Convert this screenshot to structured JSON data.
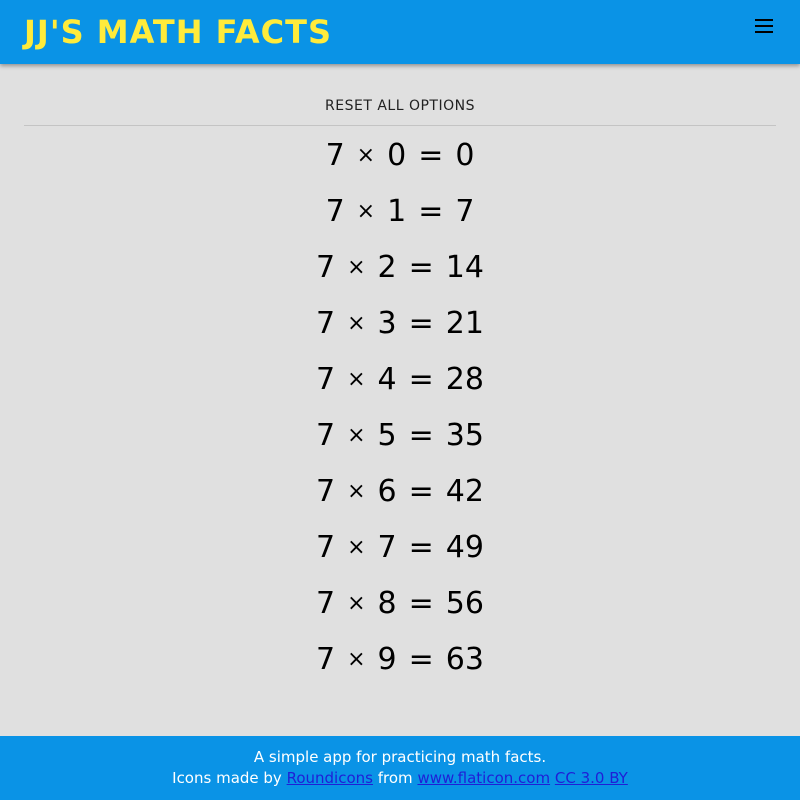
{
  "header": {
    "title": "JJ'S MATH FACTS",
    "menu_icon": "hamburger-menu-icon"
  },
  "toolbar": {
    "reset_label": "RESET ALL OPTIONS"
  },
  "facts": [
    {
      "a": "7",
      "op": "×",
      "b": "0",
      "eq": "=",
      "result": "0"
    },
    {
      "a": "7",
      "op": "×",
      "b": "1",
      "eq": "=",
      "result": "7"
    },
    {
      "a": "7",
      "op": "×",
      "b": "2",
      "eq": "=",
      "result": "14"
    },
    {
      "a": "7",
      "op": "×",
      "b": "3",
      "eq": "=",
      "result": "21"
    },
    {
      "a": "7",
      "op": "×",
      "b": "4",
      "eq": "=",
      "result": "28"
    },
    {
      "a": "7",
      "op": "×",
      "b": "5",
      "eq": "=",
      "result": "35"
    },
    {
      "a": "7",
      "op": "×",
      "b": "6",
      "eq": "=",
      "result": "42"
    },
    {
      "a": "7",
      "op": "×",
      "b": "7",
      "eq": "=",
      "result": "49"
    },
    {
      "a": "7",
      "op": "×",
      "b": "8",
      "eq": "=",
      "result": "56"
    },
    {
      "a": "7",
      "op": "×",
      "b": "9",
      "eq": "=",
      "result": "63"
    }
  ],
  "footer": {
    "line1": "A simple app for practicing math facts.",
    "icons_prefix": "Icons made by",
    "author_link": "Roundicons",
    "from_text": "from",
    "site_link": "www.flaticon.com",
    "license_link": "CC 3.0 BY"
  },
  "colors": {
    "app_bar": "#0a93e6",
    "title": "#ffeb3b",
    "background": "#e0e0e0",
    "link": "#1f1fd6"
  }
}
